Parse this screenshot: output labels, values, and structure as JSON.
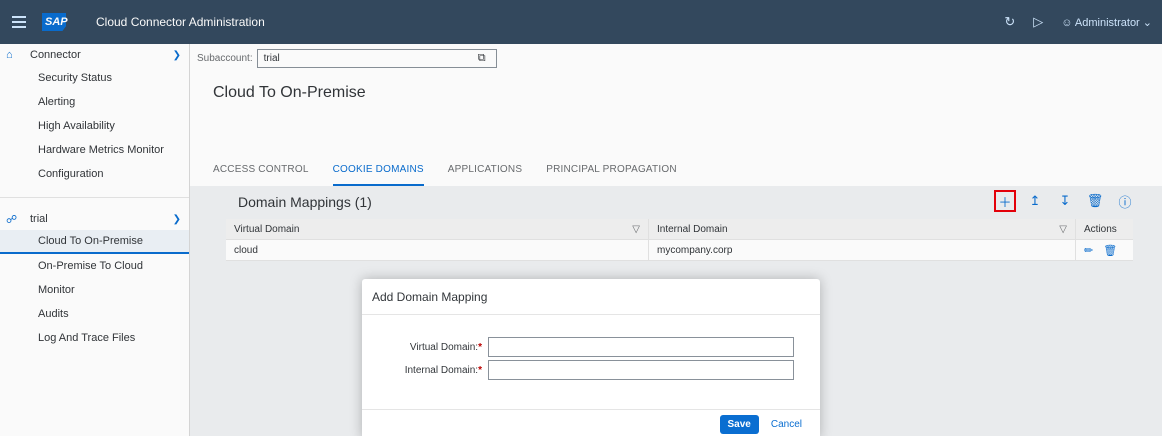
{
  "shell": {
    "logo": "SAP",
    "title": "Cloud Connector Administration",
    "user": "Administrator",
    "icons": [
      "refresh-icon",
      "play-icon",
      "user-icon",
      "chevron-down-icon"
    ]
  },
  "sidebar": {
    "connector_group": "Connector",
    "connector_items": [
      {
        "label": "Security Status"
      },
      {
        "label": "Alerting"
      },
      {
        "label": "High Availability"
      },
      {
        "label": "Hardware Metrics Monitor"
      },
      {
        "label": "Configuration"
      }
    ],
    "subaccount_group": "trial",
    "subaccount_items": [
      {
        "label": "Cloud To On-Premise"
      },
      {
        "label": "On-Premise To Cloud"
      },
      {
        "label": "Monitor"
      },
      {
        "label": "Audits"
      },
      {
        "label": "Log And Trace Files"
      }
    ]
  },
  "subaccount": {
    "label": "Subaccount:",
    "value": "trial"
  },
  "page": {
    "title": "Cloud To On-Premise",
    "tabs": [
      {
        "label": "ACCESS CONTROL"
      },
      {
        "label": "COOKIE DOMAINS"
      },
      {
        "label": "APPLICATIONS"
      },
      {
        "label": "PRINCIPAL PROPAGATION"
      }
    ],
    "active_tab": "COOKIE DOMAINS"
  },
  "table": {
    "title": "Domain Mappings (1)",
    "columns": [
      "Virtual Domain",
      "Internal Domain",
      "Actions"
    ],
    "rows": [
      {
        "virtual": "cloud",
        "internal": "mycompany.corp"
      }
    ],
    "tools": [
      "add-icon",
      "upload-icon",
      "download-icon",
      "delete-icon",
      "help-icon"
    ]
  },
  "dialog": {
    "title": "Add Domain Mapping",
    "virtual_label": "Virtual Domain:",
    "internal_label": "Internal Domain:",
    "required_mark": "*",
    "virtual_value": "",
    "internal_value": "",
    "save": "Save",
    "cancel": "Cancel"
  },
  "colors": {
    "shell": "#354a5f",
    "accent": "#0a6ed1",
    "highlight": "#e8000b"
  }
}
